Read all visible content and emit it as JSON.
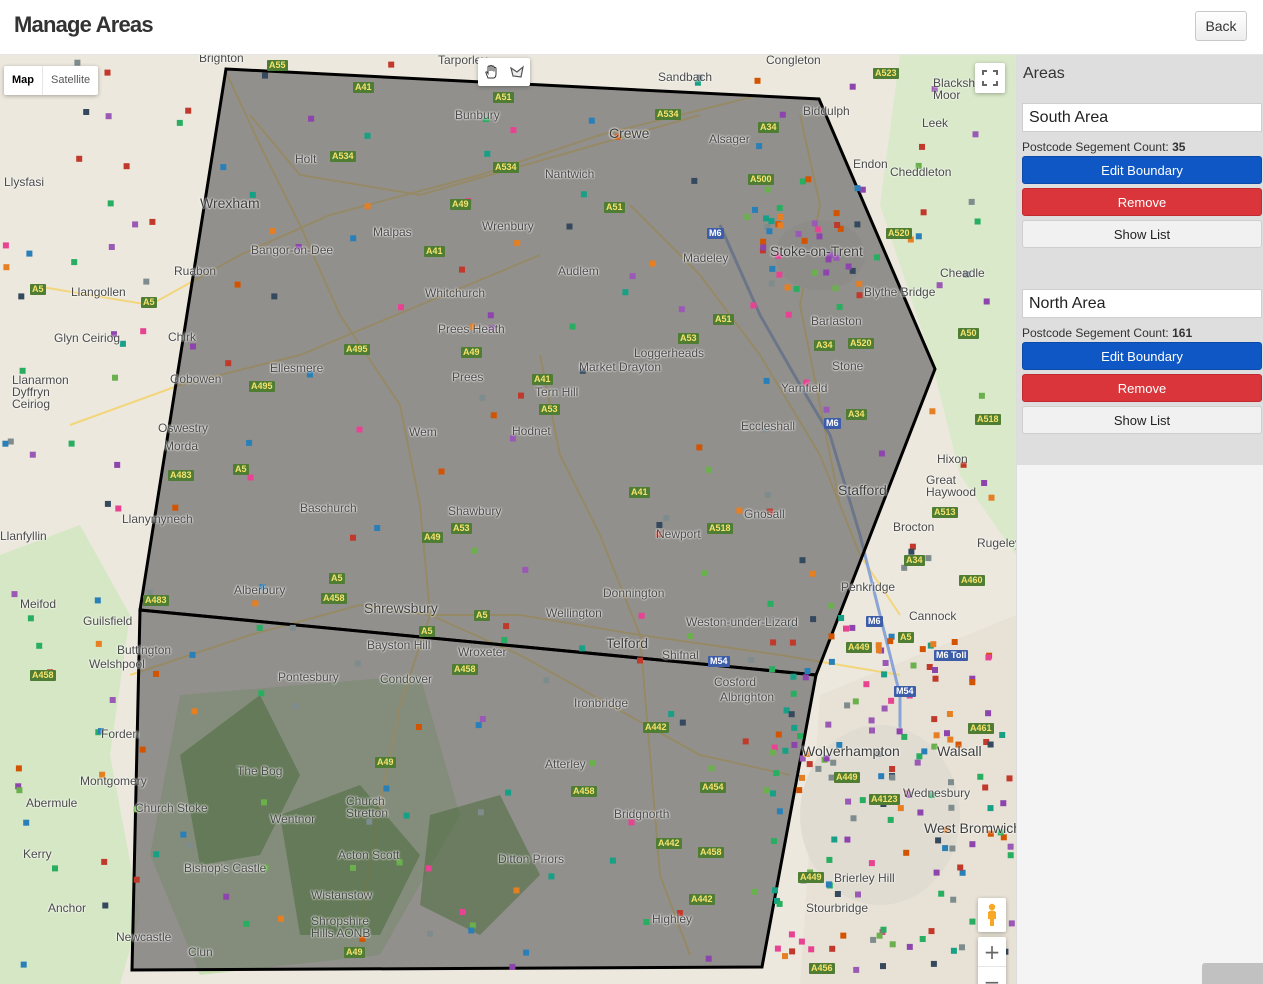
{
  "header": {
    "title": "Manage Areas",
    "back_label": "Back"
  },
  "map": {
    "type_control": {
      "map_label": "Map",
      "satellite_label": "Satellite"
    },
    "labels": [
      "Brighton",
      "Tarporley",
      "Sandbach",
      "Congleton",
      "Biddulph",
      "Blackshaw Moor",
      "Leek",
      "Bunbury",
      "Crewe",
      "Alsager",
      "Holt",
      "Wrexham",
      "Nantwich",
      "Endon",
      "Cheddleton",
      "Llysfasi",
      "Malpas",
      "Wrenbury",
      "Stoke-on-Trent",
      "Bangor-on-Dee",
      "Madeley",
      "Ruabon",
      "Audlem",
      "Cheadle",
      "Llangollen",
      "Whitchurch",
      "Blythe Bridge",
      "Glyn Ceiriog",
      "Chirk",
      "Prees Heath",
      "Barlaston",
      "Loggerheads",
      "Ellesmere",
      "Market Drayton",
      "Stone",
      "Gobowen",
      "Prees",
      "Yarnfield",
      "Llanarmon Dyffryn Ceiriog",
      "Tern Hill",
      "Wem",
      "Hodnet",
      "Eccleshall",
      "Oswestry",
      "Morda",
      "Hixon",
      "Great Haywood",
      "Stafford",
      "Llanymynech",
      "Baschurch",
      "Shawbury",
      "Gnosall",
      "Newport",
      "Brocton",
      "Llanfyllin",
      "Rugeley",
      "Alberbury",
      "Donnington",
      "Penkridge",
      "Meifod",
      "Shrewsbury",
      "Wellington",
      "Weston-under-Lizard",
      "Cannock",
      "Guilsfield",
      "Buttington",
      "Bayston Hill",
      "Wroxeter",
      "Telford",
      "Shifnal",
      "Welshpool",
      "Pontesbury",
      "Condover",
      "Cosford",
      "Albrighton",
      "Ironbridge",
      "Forden",
      "Wolverhampton",
      "Walsall",
      "The Bog",
      "Atterley",
      "Montgomery",
      "Abermule",
      "Church Stretton",
      "Church Stoke",
      "Bridgnorth",
      "Wednesbury",
      "Wentnor",
      "West Bromwich",
      "Kerry",
      "Acton Scott",
      "Ditton Priors",
      "Bishop's Castle",
      "Brierley Hill",
      "Wistanstow",
      "Anchor",
      "Stourbridge",
      "Shropshire Hills AONB",
      "Highley",
      "Newcastle",
      "Clun"
    ],
    "zoom_in": "+",
    "zoom_out": "−"
  },
  "panel": {
    "title": "Areas",
    "count_label": "Postcode Segement Count:",
    "edit_label": "Edit Boundary",
    "remove_label": "Remove",
    "list_label": "Show List",
    "areas": [
      {
        "name": "South Area",
        "count": "35"
      },
      {
        "name": "North Area",
        "count": "161"
      }
    ]
  },
  "colors": {
    "edit": "#0f57c4",
    "remove": "#d9353a",
    "polygon_fill": "#5a5a5a",
    "polygon_stroke": "#000000"
  },
  "icons": [
    "hand-icon",
    "polygon-draw-icon",
    "fullscreen-icon",
    "pegman-icon"
  ]
}
